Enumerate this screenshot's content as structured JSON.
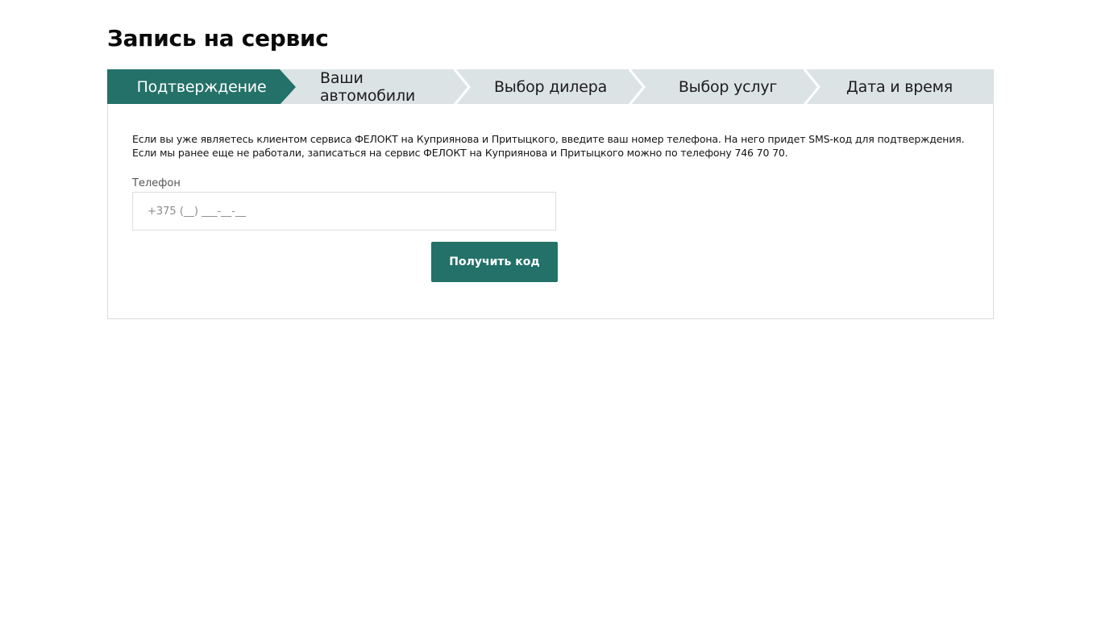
{
  "page": {
    "title": "Запись на сервис"
  },
  "steps": [
    {
      "label": "Подтверждение",
      "active": true
    },
    {
      "label": "Ваши автомобили",
      "active": false
    },
    {
      "label": "Выбор дилера",
      "active": false
    },
    {
      "label": "Выбор услуг",
      "active": false
    },
    {
      "label": "Дата и время",
      "active": false
    }
  ],
  "form": {
    "intro_line1": "Если вы уже являетесь клиентом сервиса ФЕЛОКТ на Куприянова и Притыцкого, введите ваш номер телефона. На него придет SMS-код для подтверждения.",
    "intro_line2": "Если мы ранее еще не работали, записаться на сервис ФЕЛОКТ на Куприянова и Притыцкого можно по телефону 746 70 70.",
    "phone_label": "Телефон",
    "phone_placeholder": "+375 (__) ___-__-__",
    "phone_value": "",
    "submit_label": "Получить код"
  },
  "colors": {
    "accent": "#237169",
    "step_inactive_bg": "#dce3e4",
    "border": "#dadada"
  }
}
